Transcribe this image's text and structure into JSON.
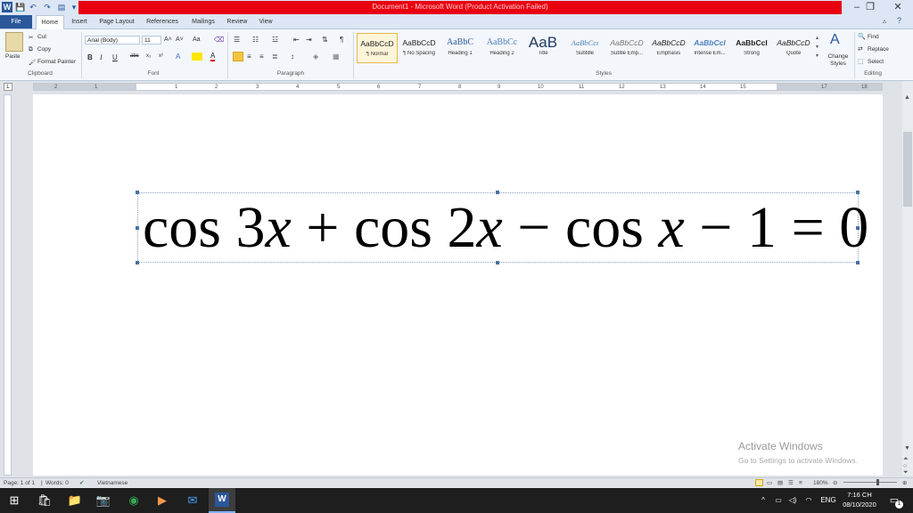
{
  "window": {
    "title": "Document1 - Microsoft Word (Product Activation Failed)",
    "app_icon": "W",
    "minimize": "–",
    "restore": "❐",
    "close": "✕",
    "title_bar_color": "#e8000f"
  },
  "tabs": [
    "File",
    "Home",
    "Insert",
    "Page Layout",
    "References",
    "Mailings",
    "Review",
    "View"
  ],
  "ribbon": {
    "clipboard": {
      "label": "Clipboard",
      "paste": "Paste",
      "cut": "Cut",
      "copy": "Copy",
      "format_painter": "Format Painter"
    },
    "font": {
      "label": "Font",
      "font_name": "Arial (Body)",
      "font_size": "11",
      "bold": "B",
      "italic": "I",
      "underline": "U"
    },
    "paragraph": {
      "label": "Paragraph"
    },
    "styles": {
      "label": "Styles",
      "items": [
        {
          "sample": "AaBbCcD",
          "name": "¶ Normal"
        },
        {
          "sample": "AaBbCcD",
          "name": "¶ No Spacing"
        },
        {
          "sample": "AaBbC",
          "name": "Heading 1"
        },
        {
          "sample": "AaBbCc",
          "name": "Heading 2"
        },
        {
          "sample": "AaB",
          "name": "Title"
        },
        {
          "sample": "AaBbCcı",
          "name": "Subtitle"
        },
        {
          "sample": "AaBbCcD",
          "name": "Subtle Emp..."
        },
        {
          "sample": "AaBbCcD",
          "name": "Emphasis"
        },
        {
          "sample": "AaBbCcI",
          "name": "Intense Em..."
        },
        {
          "sample": "AaBbCcI",
          "name": "Strong"
        },
        {
          "sample": "AaBbCcD",
          "name": "Quote"
        }
      ],
      "change_styles": "Change Styles"
    },
    "editing": {
      "label": "Editing",
      "find": "Find",
      "replace": "Replace",
      "select": "Select"
    }
  },
  "ruler": {
    "numbers": [
      "2",
      "1",
      "1",
      "2",
      "3",
      "4",
      "5",
      "6",
      "7",
      "8",
      "9",
      "10",
      "11",
      "12",
      "13",
      "14",
      "15",
      "17",
      "18"
    ]
  },
  "document": {
    "equation": {
      "parts": [
        "cos 3",
        "x",
        " + cos 2",
        "x",
        " − cos ",
        "x",
        " − 1 = 0"
      ]
    }
  },
  "watermark": {
    "line1": "Activate Windows",
    "line2": "Go to Settings to activate Windows."
  },
  "status_bar": {
    "page": "Page: 1 of 1",
    "words": "Words: 0",
    "language": "Vietnamese",
    "zoom": "180%"
  },
  "taskbar": {
    "language": "ENG",
    "time": "7:16 CH",
    "date": "08/10/2020",
    "notifications": "1"
  }
}
